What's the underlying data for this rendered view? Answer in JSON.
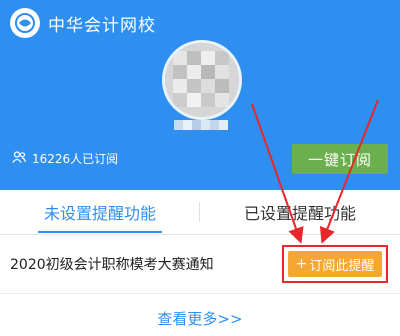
{
  "header": {
    "brand_name": "中华会计网校",
    "subscriber_text": "16226人已订阅",
    "subscribe_button": "一键订阅"
  },
  "tabs": [
    {
      "label": "未设置提醒功能",
      "active": true
    },
    {
      "label": "已设置提醒功能",
      "active": false
    }
  ],
  "items": [
    {
      "title": "2020初级会计职称模考大赛通知",
      "button_label": "订阅此提醒"
    }
  ],
  "more_link": "查看更多>>",
  "colors": {
    "header_bg": "#2e8ff0",
    "subscribe_button": "#6ab04c",
    "remind_button": "#f4a732",
    "annotation_red": "#e8262b",
    "active_tab": "#2e8ff0"
  },
  "icons": [
    "logo-icon",
    "people-icon",
    "plus-icon",
    "arrow-annotation"
  ]
}
